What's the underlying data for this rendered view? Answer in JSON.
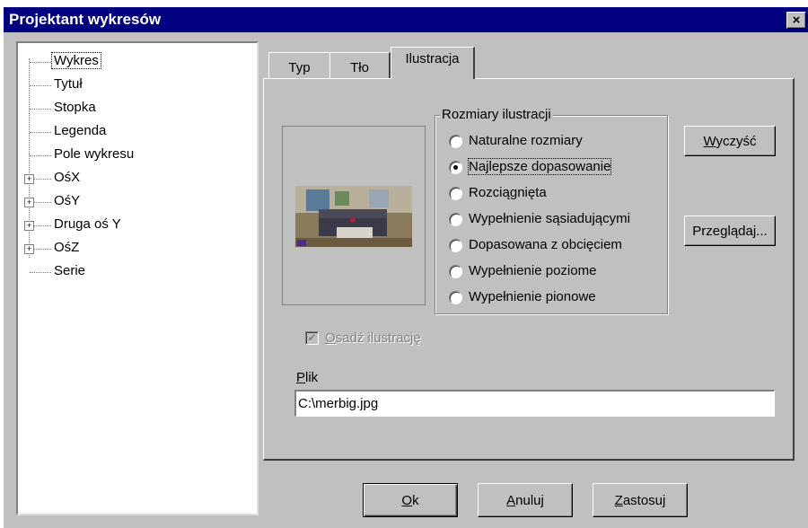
{
  "window": {
    "title": "Projektant wykresów",
    "close_glyph": "×"
  },
  "tree": [
    {
      "label": "Wykres",
      "expandable": false,
      "selected": true
    },
    {
      "label": "Tytuł",
      "expandable": false
    },
    {
      "label": "Stopka",
      "expandable": false
    },
    {
      "label": "Legenda",
      "expandable": false
    },
    {
      "label": "Pole wykresu",
      "expandable": false
    },
    {
      "label": "OśX",
      "expandable": true
    },
    {
      "label": "OśY",
      "expandable": true
    },
    {
      "label": "Druga oś Y",
      "expandable": true
    },
    {
      "label": "OśZ",
      "expandable": true
    },
    {
      "label": "Serie",
      "expandable": false
    }
  ],
  "tabs": [
    {
      "label": "Typ",
      "active": false
    },
    {
      "label": "Tło",
      "active": false
    },
    {
      "label": "Ilustracja",
      "active": true
    }
  ],
  "size_group": {
    "title": "Rozmiary ilustracji",
    "options": [
      "Naturalne rozmiary",
      "Najlepsze dopasowanie",
      "Rozciągnięta",
      "Wypełnienie sąsiadującymi",
      "Dopasowana z obcięciem",
      "Wypełnienie poziome",
      "Wypełnienie pionowe"
    ],
    "selected_index": 1
  },
  "buttons": {
    "clear_mnemonic": "W",
    "clear_rest": "yczyść",
    "browse": "Przeglądaj...",
    "ok_mnemonic": "O",
    "ok_rest": "k",
    "cancel_mnemonic": "A",
    "cancel_rest": "nuluj",
    "apply_mnemonic": "Z",
    "apply_rest": "astosuj"
  },
  "embed": {
    "mnemonic": "O",
    "rest": "sadź ilustrację",
    "checked": true,
    "disabled": true
  },
  "file": {
    "label_mnemonic": "P",
    "label_rest": "lik",
    "value": "C:\\merbig.jpg"
  },
  "icons": {
    "close": "close-icon",
    "expand": "plus-box-icon",
    "preview": "image-thumbnail"
  }
}
